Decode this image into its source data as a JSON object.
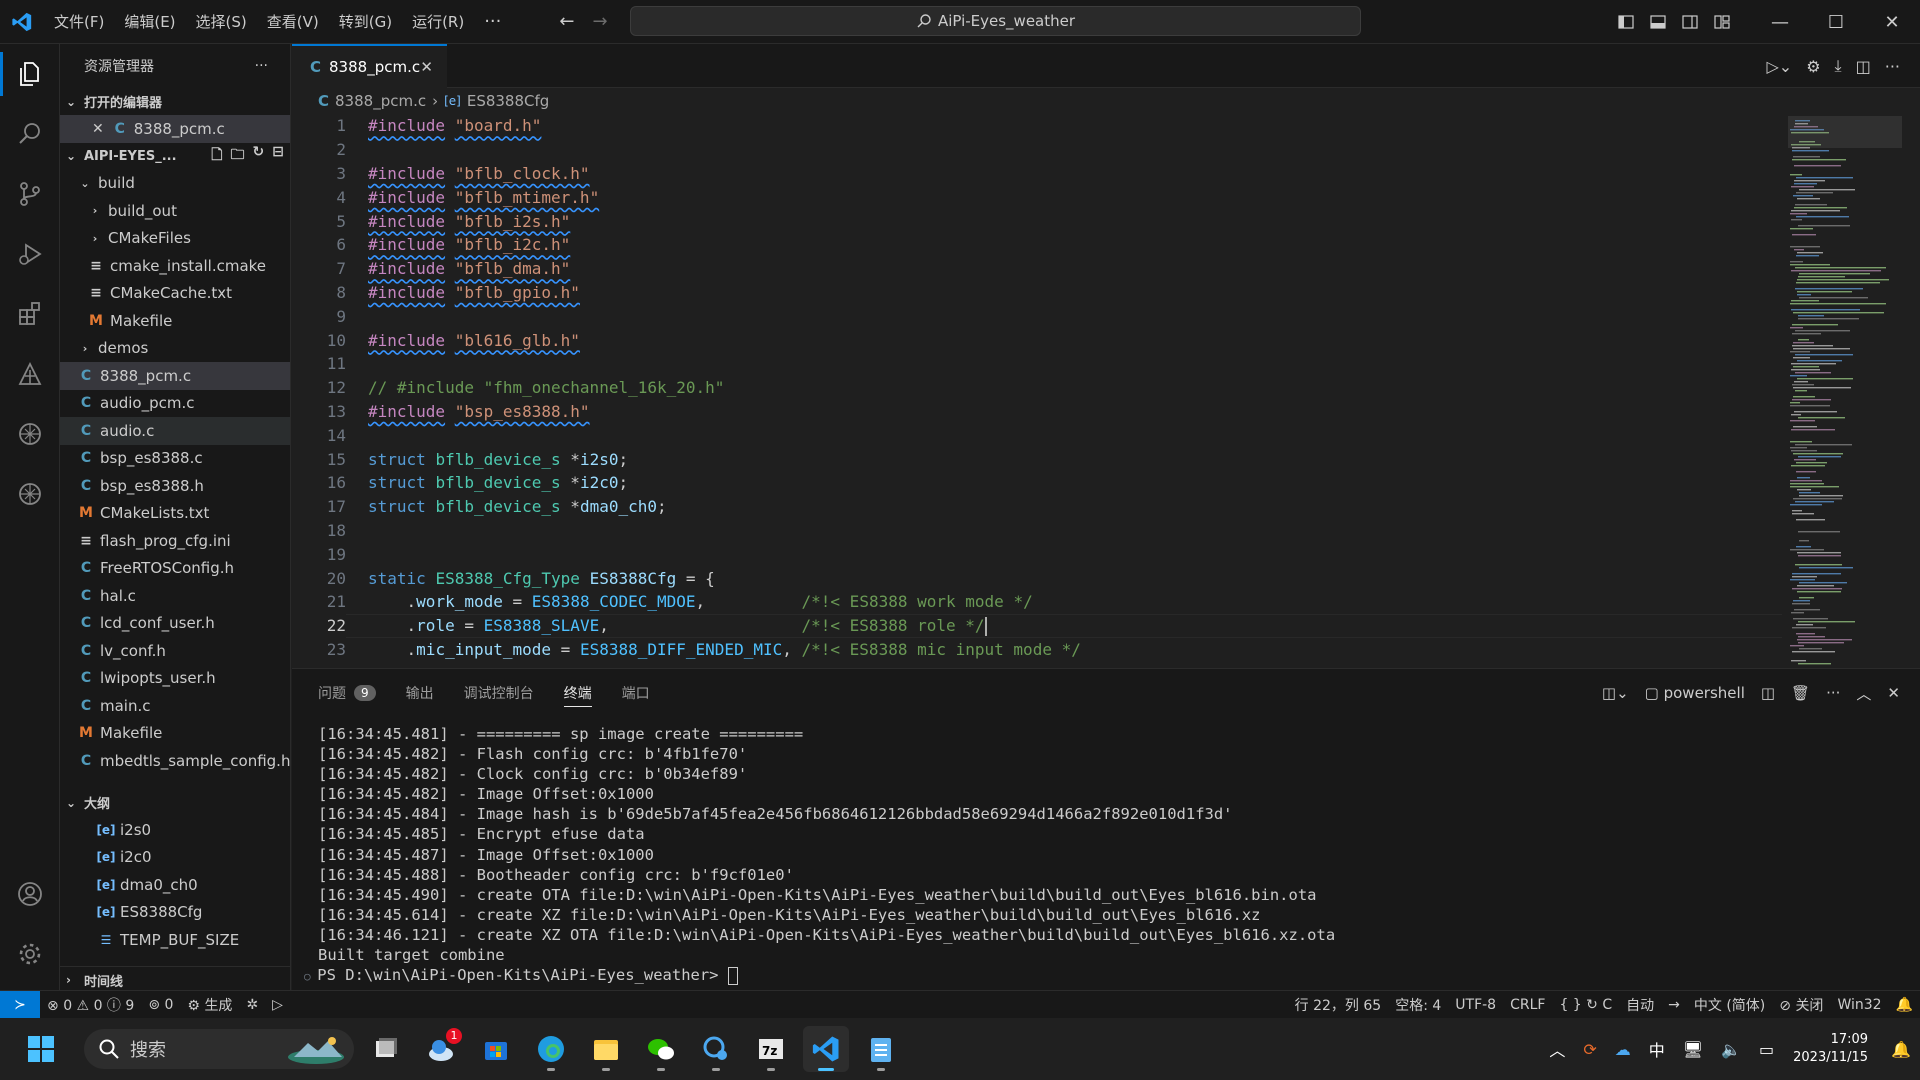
{
  "titlebar": {
    "menus": [
      "文件(F)",
      "编辑(E)",
      "选择(S)",
      "查看(V)",
      "转到(G)",
      "运行(R)"
    ],
    "more": "···",
    "search_text": "AiPi-Eyes_weather",
    "window_controls": [
      "—",
      "☐",
      "✕"
    ]
  },
  "activity": [
    "explorer-icon",
    "search-icon",
    "source-control-icon",
    "run-debug-icon",
    "extensions-icon",
    "remote-icon",
    "openai-icon",
    "openai-icon-2",
    "account-icon",
    "settings-icon"
  ],
  "sidebar": {
    "title": "资源管理器",
    "more": "···",
    "open_editors_label": "打开的编辑器",
    "open_editors": [
      {
        "name": "8388_pcm.c",
        "icon": "C"
      }
    ],
    "project_label": "AIPI-EYES_...",
    "tree": [
      {
        "name": "build",
        "kind": "folder-open",
        "depth": 1
      },
      {
        "name": "build_out",
        "kind": "folder",
        "depth": 2
      },
      {
        "name": "CMakeFiles",
        "kind": "folder",
        "depth": 2
      },
      {
        "name": "cmake_install.cmake",
        "kind": "eq",
        "depth": 2
      },
      {
        "name": "CMakeCache.txt",
        "kind": "eq",
        "depth": 2
      },
      {
        "name": "Makefile",
        "kind": "M",
        "depth": 2
      },
      {
        "name": "demos",
        "kind": "folder",
        "depth": 1
      },
      {
        "name": "8388_pcm.c",
        "kind": "C",
        "depth": 1,
        "state": "selected"
      },
      {
        "name": "audio_pcm.c",
        "kind": "C",
        "depth": 1
      },
      {
        "name": "audio.c",
        "kind": "C",
        "depth": 1,
        "state": "hover"
      },
      {
        "name": "bsp_es8388.c",
        "kind": "C",
        "depth": 1
      },
      {
        "name": "bsp_es8388.h",
        "kind": "C",
        "depth": 1
      },
      {
        "name": "CMakeLists.txt",
        "kind": "M",
        "depth": 1
      },
      {
        "name": "flash_prog_cfg.ini",
        "kind": "eq",
        "depth": 1
      },
      {
        "name": "FreeRTOSConfig.h",
        "kind": "C",
        "depth": 1
      },
      {
        "name": "hal.c",
        "kind": "C",
        "depth": 1
      },
      {
        "name": "lcd_conf_user.h",
        "kind": "C",
        "depth": 1
      },
      {
        "name": "lv_conf.h",
        "kind": "C",
        "depth": 1
      },
      {
        "name": "lwipopts_user.h",
        "kind": "C",
        "depth": 1
      },
      {
        "name": "main.c",
        "kind": "C",
        "depth": 1
      },
      {
        "name": "Makefile",
        "kind": "M",
        "depth": 1
      },
      {
        "name": "mbedtls_sample_config.h",
        "kind": "C",
        "depth": 1
      }
    ],
    "outline_label": "大纲",
    "outline": [
      {
        "name": "i2s0",
        "icon": "[e]"
      },
      {
        "name": "i2c0",
        "icon": "[e]"
      },
      {
        "name": "dma0_ch0",
        "icon": "[e]"
      },
      {
        "name": "ES8388Cfg",
        "icon": "[e]"
      },
      {
        "name": "TEMP_BUF_SIZE",
        "icon": "☰"
      }
    ],
    "timeline_label": "时间线"
  },
  "editor": {
    "tab_name": "8388_pcm.c",
    "breadcrumb_file": "8388_pcm.c",
    "breadcrumb_symbol": "ES8388Cfg",
    "current_line": 22
  },
  "code_lines": [
    {
      "n": "1",
      "t": [
        [
          "kw wavy",
          "#include"
        ],
        [
          "",
          " "
        ],
        [
          "str wavy",
          "\"board.h\""
        ]
      ]
    },
    {
      "n": "2",
      "t": []
    },
    {
      "n": "3",
      "t": [
        [
          "kw wavy",
          "#include"
        ],
        [
          "",
          " "
        ],
        [
          "str wavy",
          "\"bflb_clock.h\""
        ]
      ]
    },
    {
      "n": "4",
      "t": [
        [
          "kw wavy",
          "#include"
        ],
        [
          "",
          " "
        ],
        [
          "str wavy",
          "\"bflb_mtimer.h\""
        ]
      ]
    },
    {
      "n": "5",
      "t": [
        [
          "kw wavy",
          "#include"
        ],
        [
          "",
          " "
        ],
        [
          "str wavy",
          "\"bflb_i2s.h\""
        ]
      ]
    },
    {
      "n": "6",
      "t": [
        [
          "kw wavy",
          "#include"
        ],
        [
          "",
          " "
        ],
        [
          "str wavy",
          "\"bflb_i2c.h\""
        ]
      ]
    },
    {
      "n": "7",
      "t": [
        [
          "kw wavy",
          "#include"
        ],
        [
          "",
          " "
        ],
        [
          "str wavy",
          "\"bflb_dma.h\""
        ]
      ]
    },
    {
      "n": "8",
      "t": [
        [
          "kw wavy",
          "#include"
        ],
        [
          "",
          " "
        ],
        [
          "str wavy",
          "\"bflb_gpio.h\""
        ]
      ]
    },
    {
      "n": "9",
      "t": []
    },
    {
      "n": "10",
      "t": [
        [
          "kw wavy",
          "#include"
        ],
        [
          "",
          " "
        ],
        [
          "str wavy",
          "\"bl616_glb.h\""
        ]
      ]
    },
    {
      "n": "11",
      "t": []
    },
    {
      "n": "12",
      "t": [
        [
          "cm",
          "// #include \"fhm_onechannel_16k_20.h\""
        ]
      ]
    },
    {
      "n": "13",
      "t": [
        [
          "kw wavy",
          "#include"
        ],
        [
          "",
          " "
        ],
        [
          "str wavy",
          "\"bsp_es8388.h\""
        ]
      ]
    },
    {
      "n": "14",
      "t": []
    },
    {
      "n": "15",
      "t": [
        [
          "kb",
          "struct"
        ],
        [
          "",
          " "
        ],
        [
          "ty",
          "bflb_device_s"
        ],
        [
          "",
          " *"
        ],
        [
          "var",
          "i2s0"
        ],
        [
          "",
          ";"
        ]
      ]
    },
    {
      "n": "16",
      "t": [
        [
          "kb",
          "struct"
        ],
        [
          "",
          " "
        ],
        [
          "ty",
          "bflb_device_s"
        ],
        [
          "",
          " *"
        ],
        [
          "var",
          "i2c0"
        ],
        [
          "",
          ";"
        ]
      ]
    },
    {
      "n": "17",
      "t": [
        [
          "kb",
          "struct"
        ],
        [
          "",
          " "
        ],
        [
          "ty",
          "bflb_device_s"
        ],
        [
          "",
          " *"
        ],
        [
          "var",
          "dma0_ch0"
        ],
        [
          "",
          ";"
        ]
      ]
    },
    {
      "n": "18",
      "t": []
    },
    {
      "n": "19",
      "t": []
    },
    {
      "n": "20",
      "t": [
        [
          "kb",
          "static"
        ],
        [
          "",
          " "
        ],
        [
          "ty",
          "ES8388_Cfg_Type"
        ],
        [
          "",
          " "
        ],
        [
          "var",
          "ES8388Cfg"
        ],
        [
          "",
          " = {"
        ]
      ]
    },
    {
      "n": "21",
      "t": [
        [
          "",
          "    ."
        ],
        [
          "var",
          "work_mode"
        ],
        [
          "",
          " = "
        ],
        [
          "en",
          "ES8388_CODEC_MDOE"
        ],
        [
          "",
          ",          "
        ],
        [
          "cm",
          "/*!< ES8388 work mode */"
        ]
      ]
    },
    {
      "n": "22",
      "t": [
        [
          "",
          "    ."
        ],
        [
          "var",
          "role"
        ],
        [
          "",
          " = "
        ],
        [
          "en",
          "ES8388_SLAVE"
        ],
        [
          "",
          ",                    "
        ],
        [
          "cm",
          "/*!< ES8388 role */"
        ]
      ]
    },
    {
      "n": "23",
      "t": [
        [
          "",
          "    ."
        ],
        [
          "var",
          "mic_input_mode"
        ],
        [
          "",
          " = "
        ],
        [
          "en",
          "ES8388_DIFF_ENDED_MIC"
        ],
        [
          "",
          ", "
        ],
        [
          "cm",
          "/*!< ES8388 mic input mode */"
        ]
      ]
    }
  ],
  "panel": {
    "tabs": [
      "问题",
      "输出",
      "调试控制台",
      "终端",
      "端口"
    ],
    "problems_count": "9",
    "active_tab": "终端",
    "shell": "powershell"
  },
  "terminal_lines": [
    "[16:34:45.481] - ========= sp image create =========",
    "[16:34:45.482] - Flash config crc: b'4fb1fe70'",
    "[16:34:45.482] - Clock config crc: b'0b34ef89'",
    "[16:34:45.482] - Image Offset:0x1000",
    "[16:34:45.484] - Image hash is b'69de5b7af45fea2e456fb6864612126bbdad58e69294d1466a2f892e010d1f3d'",
    "[16:34:45.485] - Encrypt efuse data",
    "[16:34:45.487] - Image Offset:0x1000",
    "[16:34:45.488] - Bootheader config crc: b'f9cf01e0'",
    "[16:34:45.490] - create OTA file:D:\\win\\AiPi-Open-Kits\\AiPi-Eyes_weather\\build\\build_out\\Eyes_bl616.bin.ota",
    "[16:34:45.614] - create XZ file:D:\\win\\AiPi-Open-Kits\\AiPi-Eyes_weather\\build\\build_out\\Eyes_bl616.xz",
    "[16:34:46.121] - create XZ OTA file:D:\\win\\AiPi-Open-Kits\\AiPi-Eyes_weather\\build\\build_out\\Eyes_bl616.xz.ota",
    "Built target combine"
  ],
  "terminal_prompt": "PS D:\\win\\AiPi-Open-Kits\\AiPi-Eyes_weather>",
  "statusbar": {
    "errors": "0",
    "warnings": "0",
    "infos": "9",
    "ports": "0",
    "build": "生成",
    "position": "行 22，列 65",
    "spaces": "空格: 4",
    "encoding": "UTF-8",
    "eol": "CRLF",
    "language": "C",
    "auto": "自动",
    "locale": "中文 (简体)",
    "close": "关闭",
    "platform": "Win32"
  },
  "taskbar": {
    "search_placeholder": "搜索",
    "weather_badge": "1",
    "time": "17:09",
    "date": "2023/11/15",
    "ime": "中"
  },
  "colors": {
    "accent": "#0078d4",
    "editor_bg": "#1f1f1f",
    "chrome_bg": "#181818"
  }
}
